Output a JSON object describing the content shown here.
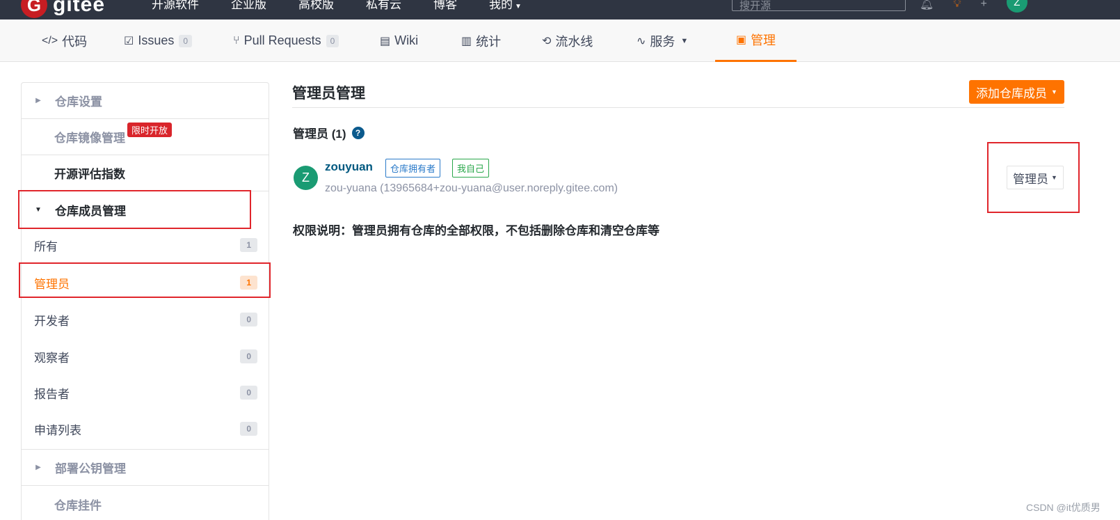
{
  "topbar": {
    "logo_mark": "G",
    "logo_text": "gitee",
    "nav": [
      "开源软件",
      "企业版",
      "高校版",
      "私有云",
      "博客",
      "我的"
    ],
    "search_placeholder": "搜开源",
    "avatar_letter": "Z"
  },
  "tabs": [
    {
      "label": "代码",
      "icon": "code-icon"
    },
    {
      "label": "Issues",
      "icon": "issues-icon",
      "badge": "0"
    },
    {
      "label": "Pull Requests",
      "icon": "pull-request-icon",
      "badge": "0"
    },
    {
      "label": "Wiki",
      "icon": "wiki-icon"
    },
    {
      "label": "统计",
      "icon": "stats-icon"
    },
    {
      "label": "流水线",
      "icon": "pipeline-icon"
    },
    {
      "label": "服务",
      "icon": "service-icon"
    },
    {
      "label": "管理",
      "icon": "manage-icon",
      "active": true
    }
  ],
  "sidebar": {
    "repo_settings": "仓库设置",
    "mirror_manage": "仓库镜像管理",
    "limited_badge": "限时开放",
    "oss_index": "开源评估指数",
    "member_manage": "仓库成员管理",
    "items": [
      {
        "label": "所有",
        "count": "1"
      },
      {
        "label": "管理员",
        "count": "1",
        "active": true
      },
      {
        "label": "开发者",
        "count": "0"
      },
      {
        "label": "观察者",
        "count": "0"
      },
      {
        "label": "报告者",
        "count": "0"
      },
      {
        "label": "申请列表",
        "count": "0"
      }
    ],
    "deploy_keys": "部署公钥管理",
    "webhooks": "仓库挂件"
  },
  "main": {
    "title": "管理员管理",
    "add_button": "添加仓库成员",
    "section_title": "管理员 (1)",
    "help_symbol": "?",
    "member": {
      "avatar_letter": "Z",
      "name": "zouyuan",
      "tag_owner": "仓库拥有者",
      "tag_self": "我自己",
      "email": "zou-yuana (13965684+zou-yuana@user.noreply.gitee.com)",
      "role": "管理员"
    },
    "permission_note": "权限说明：管理员拥有仓库的全部权限，不包括删除仓库和清空仓库等"
  },
  "watermark": "CSDN @it优质男",
  "colors": {
    "accent": "#fe7300",
    "topbar": "#2f3542",
    "highlight": "#e0252b",
    "avatar": "#1a9b73"
  }
}
